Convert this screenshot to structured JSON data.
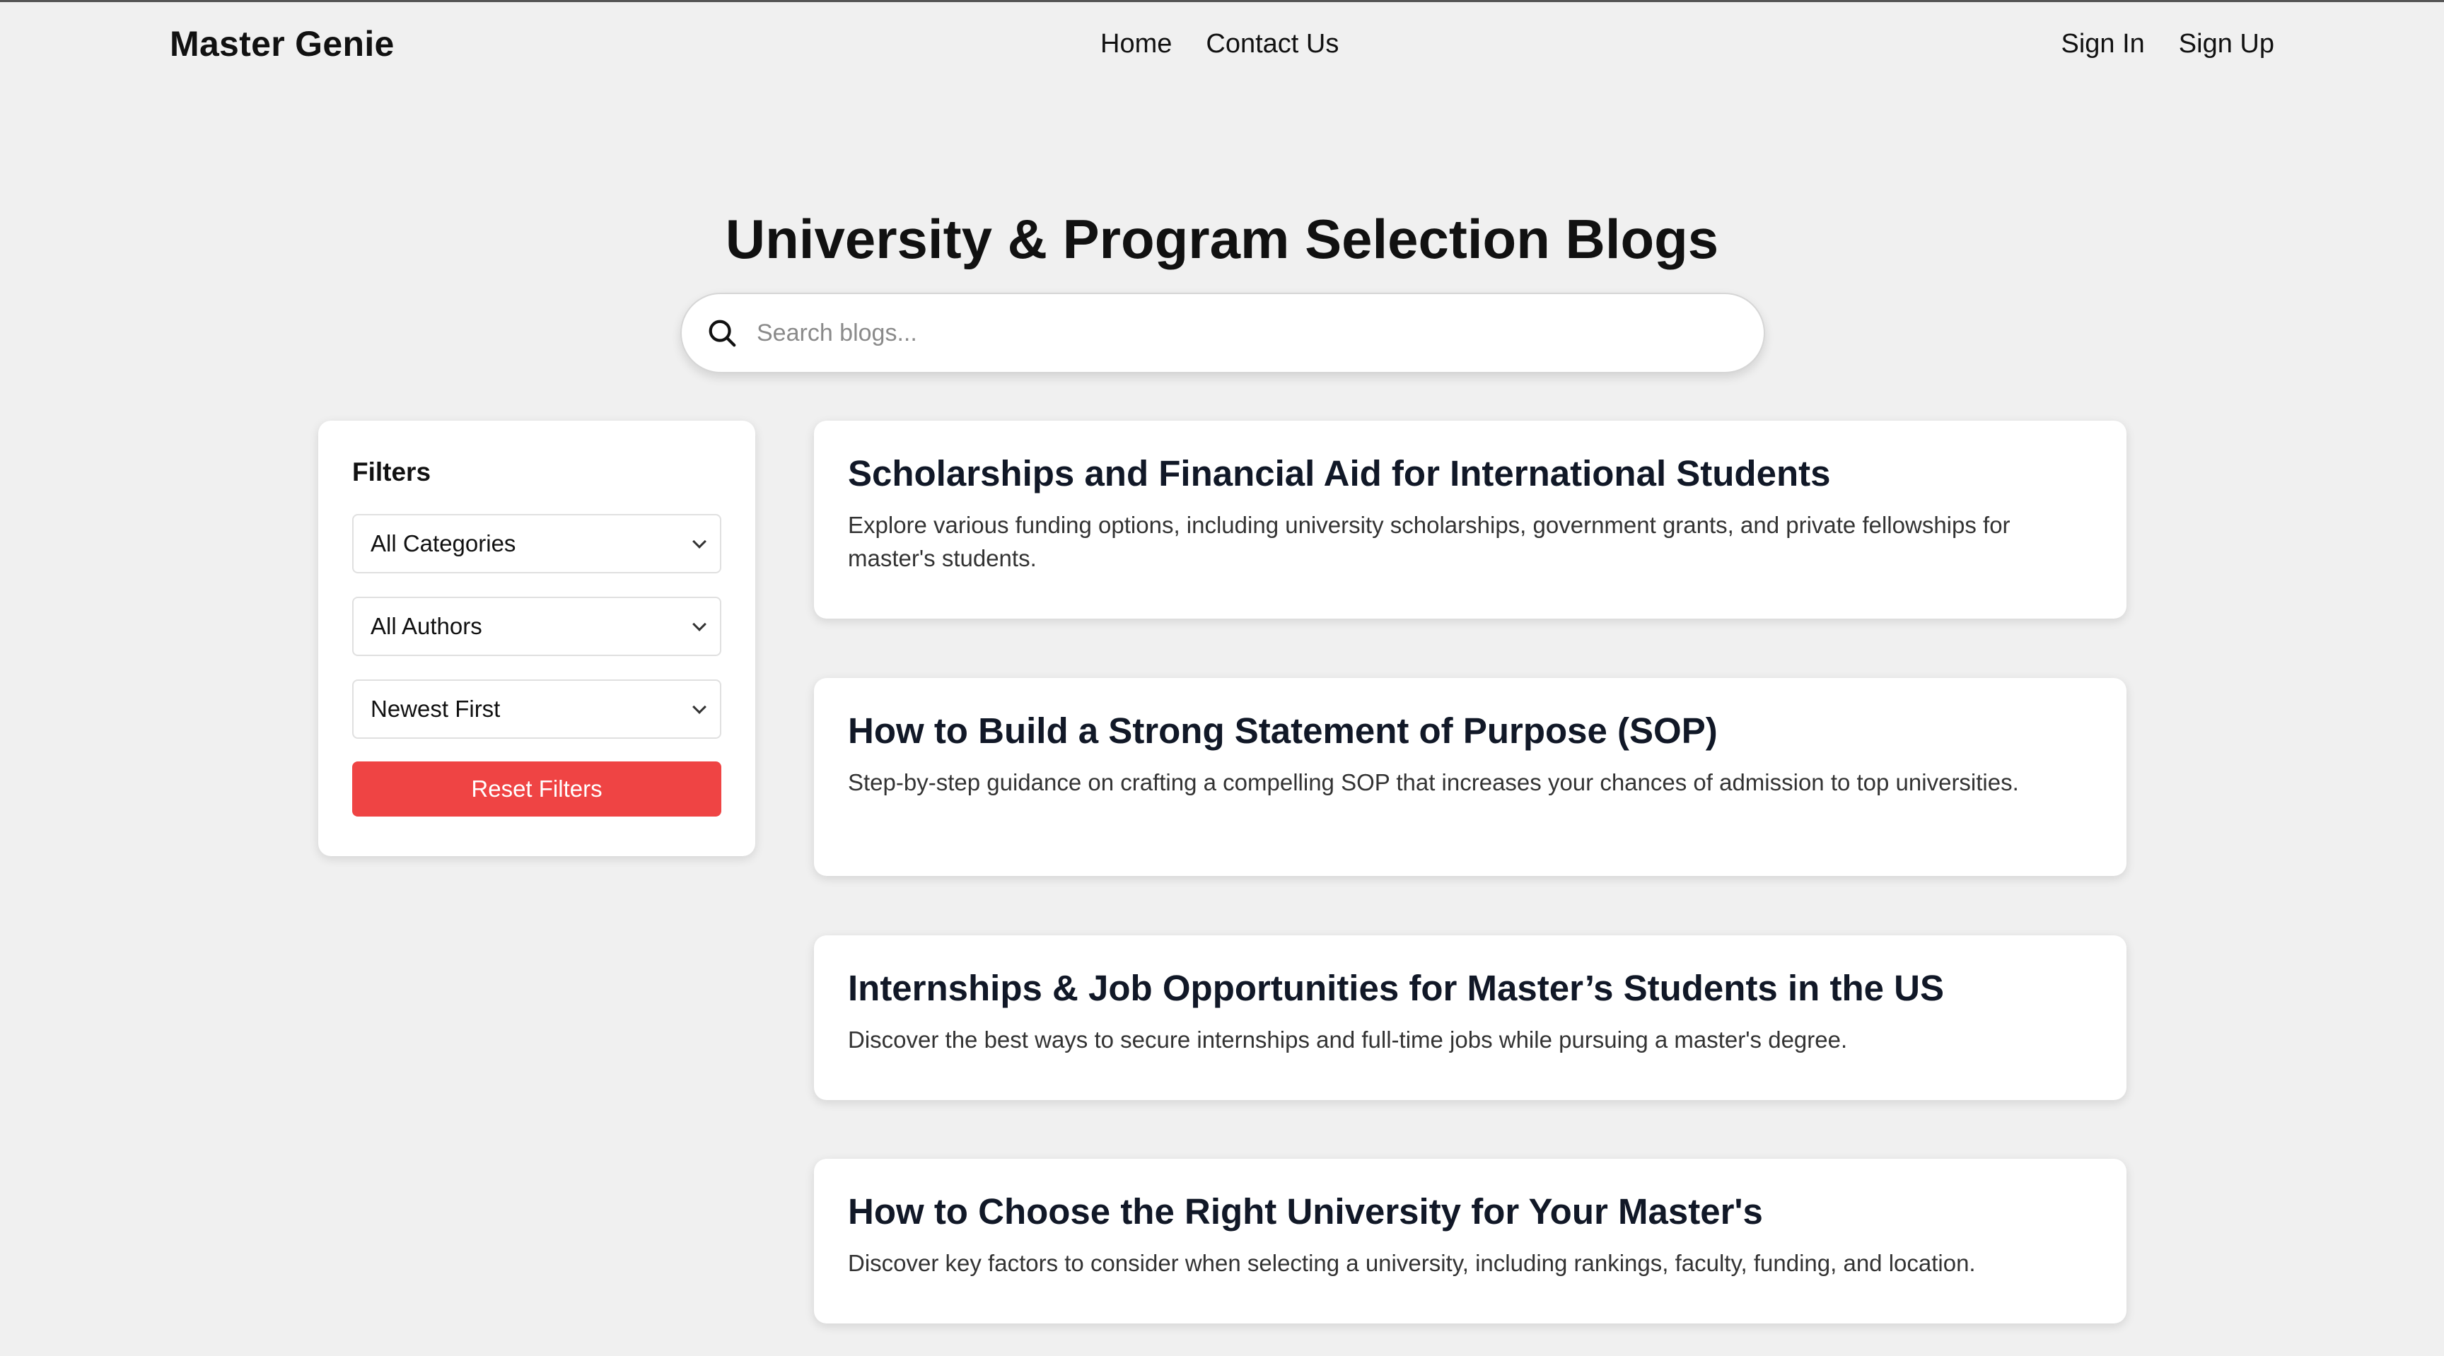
{
  "header": {
    "brand": "Master Genie",
    "nav": [
      {
        "label": "Home"
      },
      {
        "label": "Contact Us"
      }
    ],
    "auth": [
      {
        "label": "Sign In"
      },
      {
        "label": "Sign Up"
      }
    ]
  },
  "hero": {
    "title": "University & Program Selection Blogs",
    "search": {
      "placeholder": "Search blogs...",
      "value": ""
    }
  },
  "filters": {
    "title": "Filters",
    "category": "All Categories",
    "author": "All Authors",
    "sort": "Newest First",
    "reset_label": "Reset Filters",
    "reset_color": "#ef4444"
  },
  "blogs": [
    {
      "title": "Scholarships and Financial Aid for International Students",
      "description": "Explore various funding options, including university scholarships, government grants, and private fellowships for master's students."
    },
    {
      "title": "How to Build a Strong Statement of Purpose (SOP)",
      "description": "Step-by-step guidance on crafting a compelling SOP that increases your chances of admission to top universities."
    },
    {
      "title": "Internships & Job Opportunities for Master’s Students in the US",
      "description": "Discover the best ways to secure internships and full-time jobs while pursuing a master's degree."
    },
    {
      "title": "How to Choose the Right University for Your Master's",
      "description": "Discover key factors to consider when selecting a university, including rankings, faculty, funding, and location."
    }
  ]
}
